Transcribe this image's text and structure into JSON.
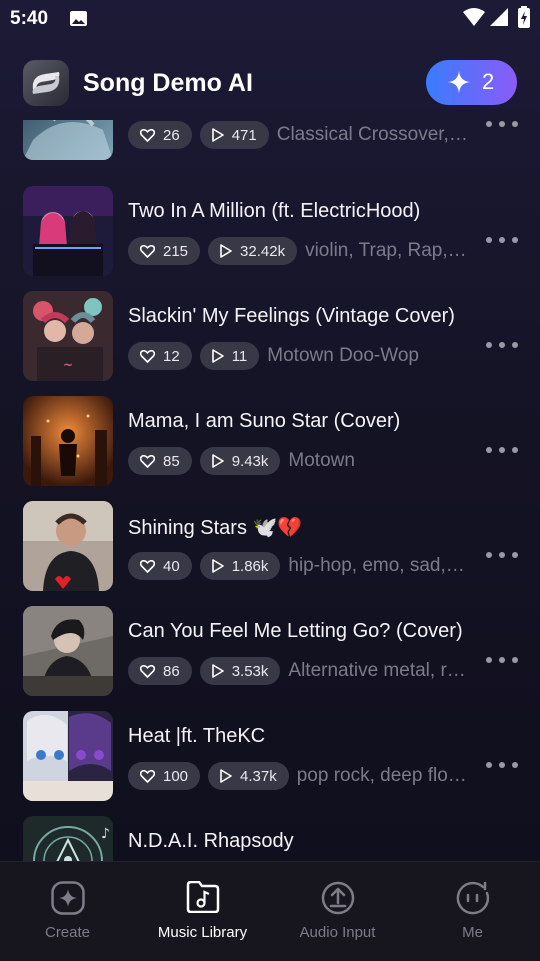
{
  "status_bar": {
    "time": "5:40"
  },
  "header": {
    "app_title": "Song Demo AI",
    "credits": "2"
  },
  "songs": [
    {
      "title": "",
      "likes": "26",
      "plays": "471",
      "genre": "Classical Crossover, Cinematic"
    },
    {
      "title": "Two In A Million (ft. ElectricHood)",
      "likes": "215",
      "plays": "32.42k",
      "genre": "violin, Trap, Rap, Hip-hop"
    },
    {
      "title": "Slackin' My Feelings (Vintage Cover)",
      "likes": "12",
      "plays": "11",
      "genre": "Motown Doo-Wop"
    },
    {
      "title": "Mama, I am Suno Star (Cover)",
      "likes": "85",
      "plays": "9.43k",
      "genre": "Motown"
    },
    {
      "title": " Shining Stars 🕊️💔",
      "likes": "40",
      "plays": "1.86k",
      "genre": "hip-hop, emo, sad, melodic"
    },
    {
      "title": "Can You Feel Me Letting Go? (Cover)",
      "likes": "86",
      "plays": "3.53k",
      "genre": "Alternative metal, rock"
    },
    {
      "title": "Heat |ft. TheKC",
      "likes": "100",
      "plays": "4.37k",
      "genre": "pop rock, deep flow, rap"
    },
    {
      "title": "N.D.A.I. Rhapsody",
      "likes": "",
      "plays": "",
      "genre": ""
    }
  ],
  "nav": [
    {
      "label": "Create",
      "icon": "sparkle-icon"
    },
    {
      "label": "Music Library",
      "icon": "music-folder-icon"
    },
    {
      "label": "Audio Input",
      "icon": "upload-icon"
    },
    {
      "label": "Me",
      "icon": "smiley-face-icon"
    }
  ],
  "colors": {
    "accent_start": "#3a7cff",
    "accent_end": "#8a5cf6",
    "background": "#141324",
    "pill": "#393847"
  }
}
